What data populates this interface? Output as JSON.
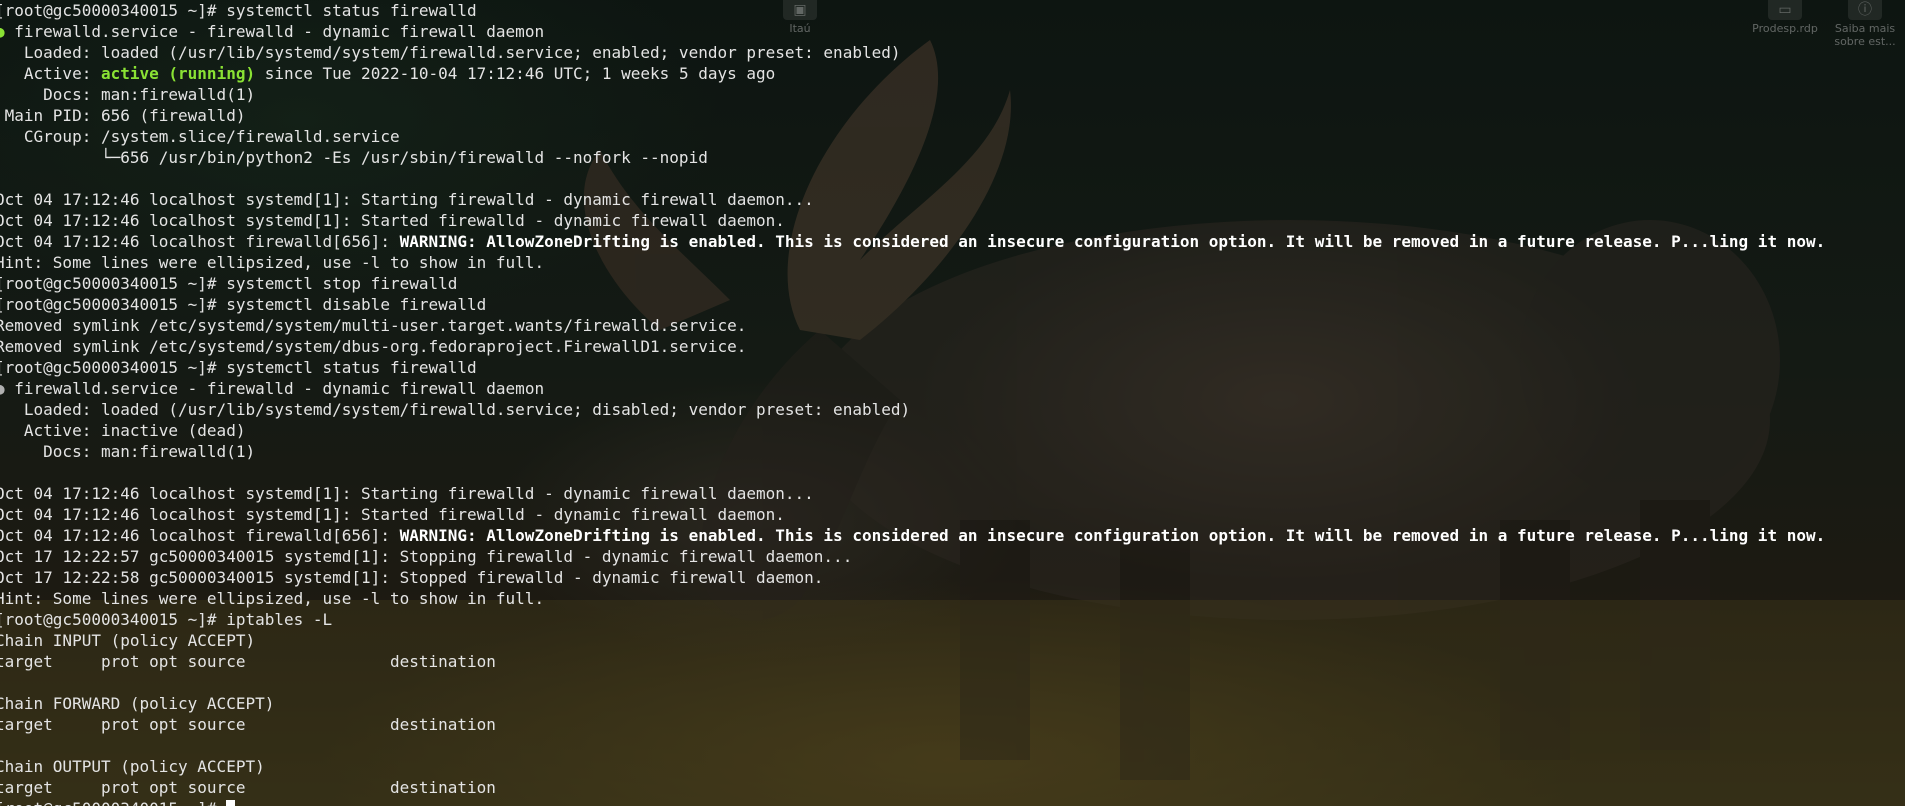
{
  "colors": {
    "text": "#e4e4e4",
    "bold": "#ffffff",
    "active_green": "#8ae234",
    "bullet_green": "#8ae234",
    "bullet_dim": "#b0b0b0"
  },
  "desktop_icons": [
    {
      "label": "Itaú",
      "icon": "bank-shortcut-icon"
    },
    {
      "label": "Prodesp.rdp",
      "icon": "rdp-file-icon"
    },
    {
      "label": "Saiba mais sobre est...",
      "icon": "info-shortcut-icon"
    }
  ],
  "terminal": {
    "lines": [
      {
        "type": "prompt",
        "prompt": "[root@gc50000340015 ~]# ",
        "cmd": "systemctl status firewalld"
      },
      {
        "type": "svc",
        "bullet": "●",
        "text": " firewalld.service - firewalld - dynamic firewall daemon"
      },
      {
        "type": "plain",
        "text": "   Loaded: loaded (/usr/lib/systemd/system/firewalld.service; enabled; vendor preset: enabled)"
      },
      {
        "type": "active",
        "pre": "   Active: ",
        "status": "active (running)",
        "post": " since Tue 2022-10-04 17:12:46 UTC; 1 weeks 5 days ago"
      },
      {
        "type": "plain",
        "text": "     Docs: man:firewalld(1)"
      },
      {
        "type": "plain",
        "text": " Main PID: 656 (firewalld)"
      },
      {
        "type": "plain",
        "text": "   CGroup: /system.slice/firewalld.service"
      },
      {
        "type": "plain",
        "text": "           └─656 /usr/bin/python2 -Es /usr/sbin/firewalld --nofork --nopid"
      },
      {
        "type": "plain",
        "text": ""
      },
      {
        "type": "plain",
        "text": "Oct 04 17:12:46 localhost systemd[1]: Starting firewalld - dynamic firewall daemon..."
      },
      {
        "type": "plain",
        "text": "Oct 04 17:12:46 localhost systemd[1]: Started firewalld - dynamic firewall daemon."
      },
      {
        "type": "log_bold",
        "pre": "Oct 04 17:12:46 localhost firewalld[656]: ",
        "bold": "WARNING: AllowZoneDrifting is enabled. This is considered an insecure configuration option. It will be removed in a future release. P...ling it now."
      },
      {
        "type": "plain",
        "text": "Hint: Some lines were ellipsized, use -l to show in full."
      },
      {
        "type": "prompt",
        "prompt": "[root@gc50000340015 ~]# ",
        "cmd": "systemctl stop firewalld"
      },
      {
        "type": "prompt",
        "prompt": "[root@gc50000340015 ~]# ",
        "cmd": "systemctl disable firewalld"
      },
      {
        "type": "plain",
        "text": "Removed symlink /etc/systemd/system/multi-user.target.wants/firewalld.service."
      },
      {
        "type": "plain",
        "text": "Removed symlink /etc/systemd/system/dbus-org.fedoraproject.FirewallD1.service."
      },
      {
        "type": "prompt",
        "prompt": "[root@gc50000340015 ~]# ",
        "cmd": "systemctl status firewalld"
      },
      {
        "type": "svc_dim",
        "bullet": "●",
        "text": " firewalld.service - firewalld - dynamic firewall daemon"
      },
      {
        "type": "plain",
        "text": "   Loaded: loaded (/usr/lib/systemd/system/firewalld.service; disabled; vendor preset: enabled)"
      },
      {
        "type": "plain",
        "text": "   Active: inactive (dead)"
      },
      {
        "type": "plain",
        "text": "     Docs: man:firewalld(1)"
      },
      {
        "type": "plain",
        "text": ""
      },
      {
        "type": "plain",
        "text": "Oct 04 17:12:46 localhost systemd[1]: Starting firewalld - dynamic firewall daemon..."
      },
      {
        "type": "plain",
        "text": "Oct 04 17:12:46 localhost systemd[1]: Started firewalld - dynamic firewall daemon."
      },
      {
        "type": "log_bold",
        "pre": "Oct 04 17:12:46 localhost firewalld[656]: ",
        "bold": "WARNING: AllowZoneDrifting is enabled. This is considered an insecure configuration option. It will be removed in a future release. P...ling it now."
      },
      {
        "type": "plain",
        "text": "Oct 17 12:22:57 gc50000340015 systemd[1]: Stopping firewalld - dynamic firewall daemon..."
      },
      {
        "type": "plain",
        "text": "Oct 17 12:22:58 gc50000340015 systemd[1]: Stopped firewalld - dynamic firewall daemon."
      },
      {
        "type": "plain",
        "text": "Hint: Some lines were ellipsized, use -l to show in full."
      },
      {
        "type": "prompt",
        "prompt": "[root@gc50000340015 ~]# ",
        "cmd": "iptables -L"
      },
      {
        "type": "plain",
        "text": "Chain INPUT (policy ACCEPT)"
      },
      {
        "type": "plain",
        "text": "target     prot opt source               destination"
      },
      {
        "type": "plain",
        "text": ""
      },
      {
        "type": "plain",
        "text": "Chain FORWARD (policy ACCEPT)"
      },
      {
        "type": "plain",
        "text": "target     prot opt source               destination"
      },
      {
        "type": "plain",
        "text": ""
      },
      {
        "type": "plain",
        "text": "Chain OUTPUT (policy ACCEPT)"
      },
      {
        "type": "plain",
        "text": "target     prot opt source               destination"
      },
      {
        "type": "input",
        "prompt": "[root@gc50000340015 ~]# ",
        "cmd": ""
      }
    ]
  }
}
